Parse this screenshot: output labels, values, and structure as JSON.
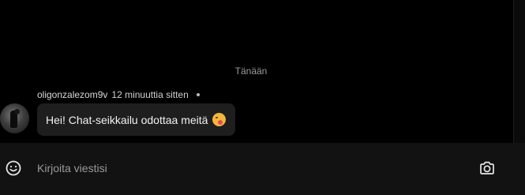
{
  "chat": {
    "date_separator": "Tänään",
    "messages": [
      {
        "username": "oligonzalezom9v",
        "time": "12 minuuttia sitten",
        "text": "Hei! Chat-seikkailu odottaa meitä",
        "emoji_icon": "tongue-wink-emoji-icon"
      }
    ]
  },
  "composer": {
    "placeholder": "Kirjoita viestisi",
    "value": "",
    "left_icon": "emoji-smile-icon",
    "right_icon": "camera-icon"
  },
  "colors": {
    "background": "#000000",
    "bubble": "#1e1e1e",
    "composer": "#121212",
    "muted_text": "#9a9a9a"
  }
}
